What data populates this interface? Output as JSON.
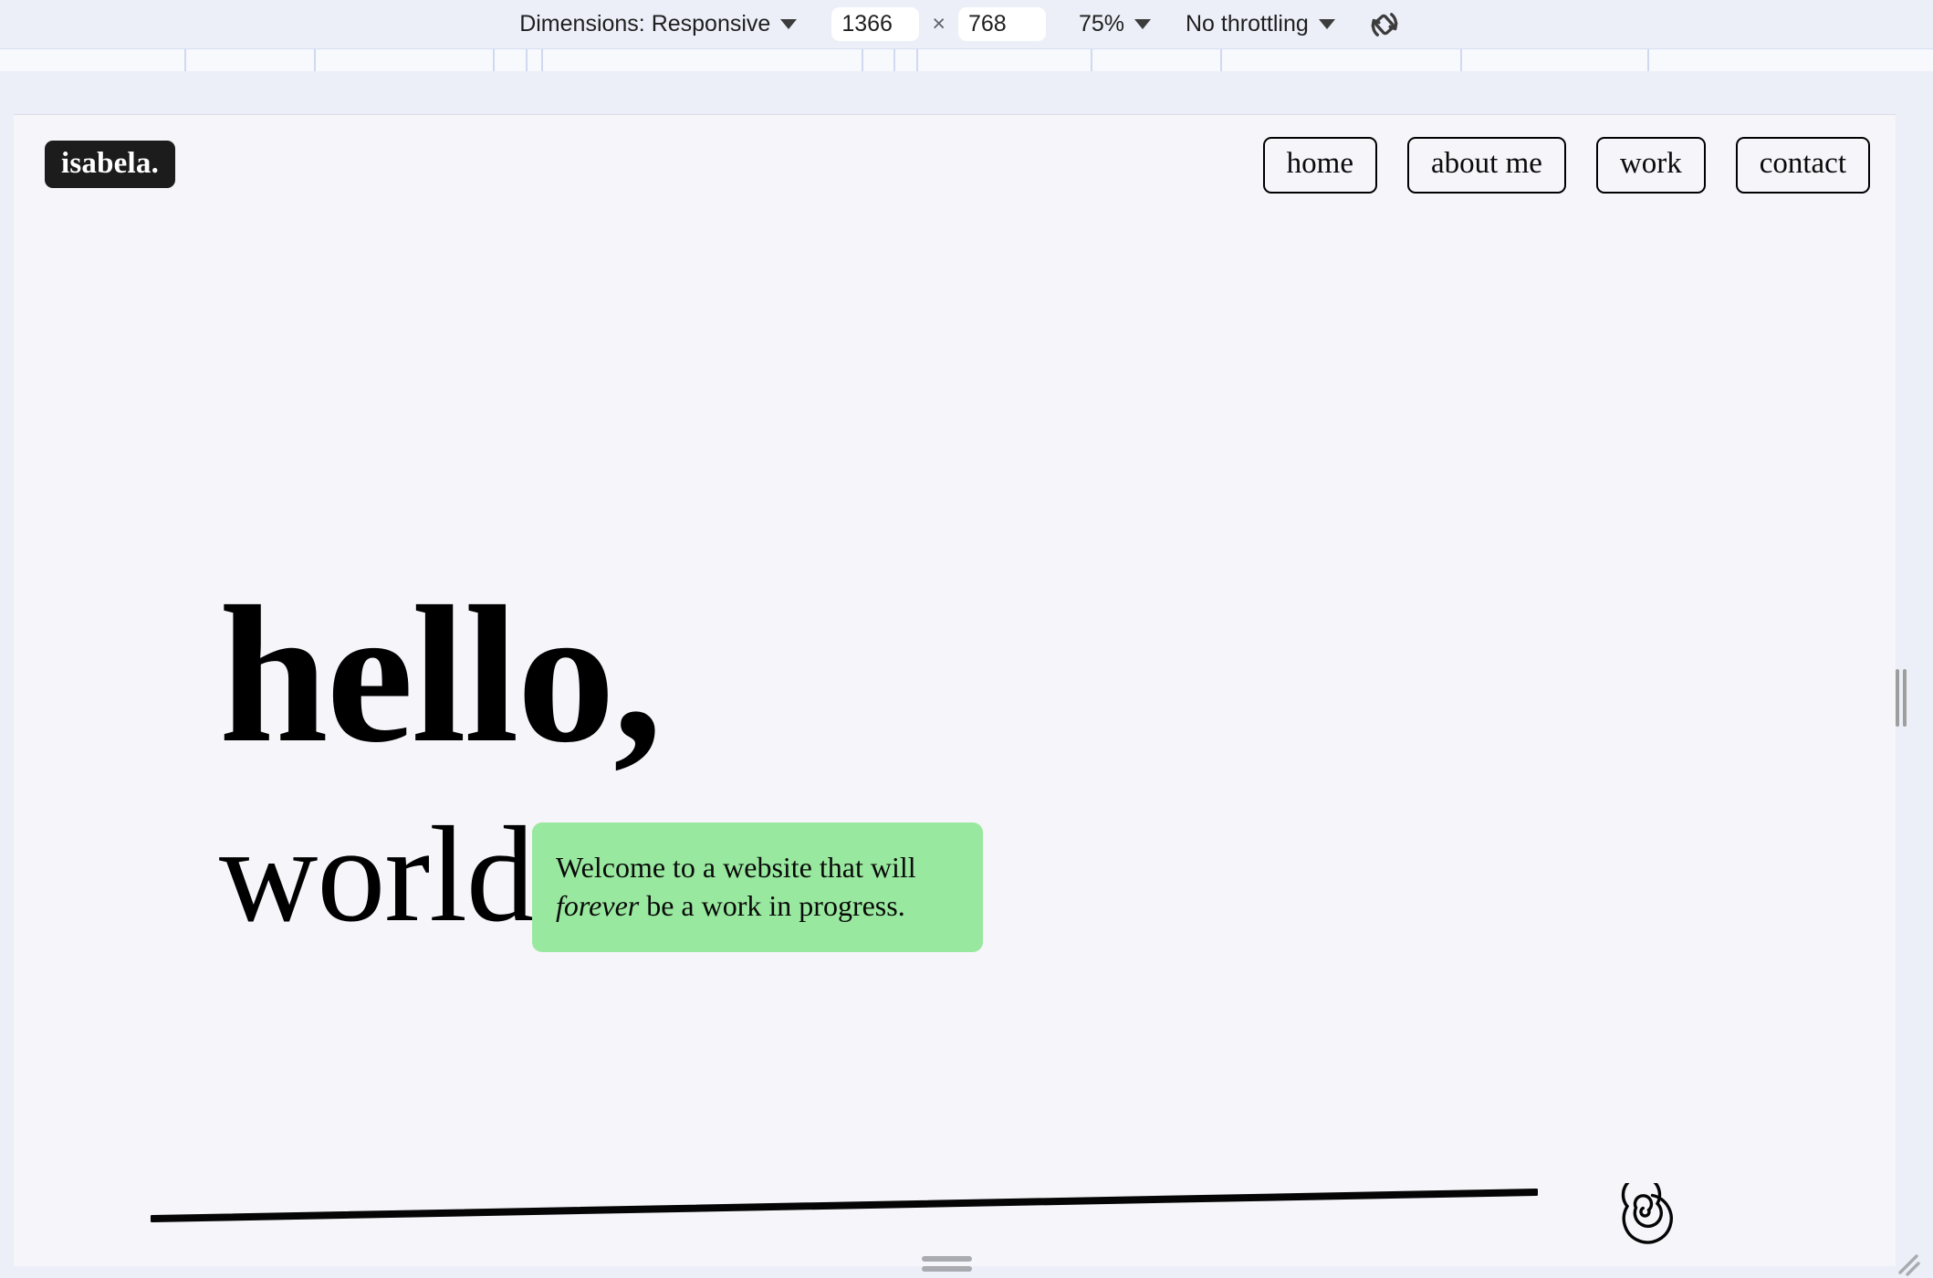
{
  "devtools": {
    "dimensions_label": "Dimensions: Responsive",
    "width_value": "1366",
    "times_symbol": "×",
    "height_value": "768",
    "zoom_label": "75%",
    "throttling_label": "No throttling",
    "rotate_icon": "rotate-device-icon",
    "caret_icon": "chevron-down-icon",
    "ruler_ticks": [
      202,
      344,
      540,
      576,
      593,
      944,
      979,
      1004,
      1195,
      1337,
      1600,
      1805
    ],
    "stage_bg": "#eceff8",
    "ruler_bg": "#f7f9fd",
    "tick_color": "#cfd9f0"
  },
  "site": {
    "page_bg": "#f5f5fa",
    "logo": {
      "text": "isabela.",
      "bg": "#1c1c1c",
      "fg": "#ffffff"
    },
    "nav": [
      {
        "label": "home",
        "name": "nav-home"
      },
      {
        "label": "about me",
        "name": "nav-about-me"
      },
      {
        "label": "work",
        "name": "nav-work"
      },
      {
        "label": "contact",
        "name": "nav-contact"
      }
    ],
    "hero": {
      "line1": "hello,",
      "line2": "world.",
      "callout": {
        "bg": "#99e89f",
        "line1_before": "Welcome to a website that will",
        "line2_em": "forever",
        "line2_after": " be a work in progress."
      }
    },
    "decor": {
      "line_name": "hand-drawn-underline",
      "spiral_name": "spiral-icon",
      "stroke_color": "#000000"
    }
  },
  "handles": {
    "right": "resize-handle-right",
    "bottom": "resize-handle-bottom",
    "corner": "resize-handle-corner"
  }
}
